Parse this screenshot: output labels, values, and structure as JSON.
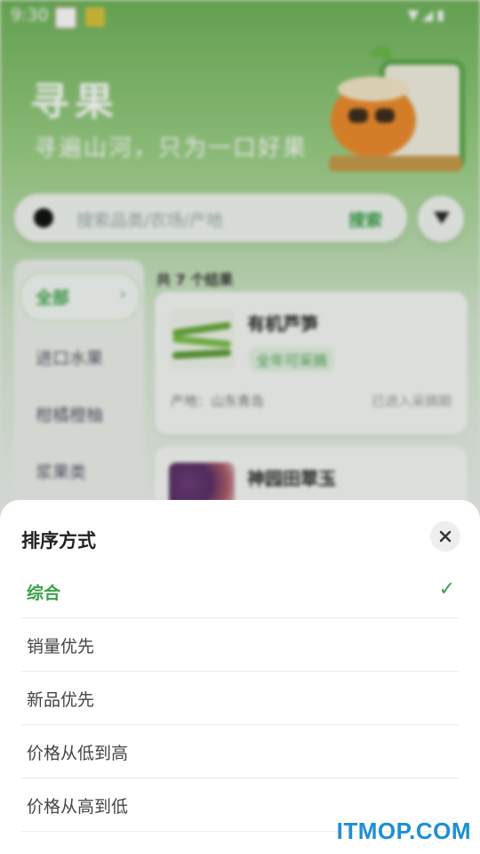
{
  "status_bar": {
    "time": "9:30"
  },
  "hero": {
    "title": "寻果",
    "subtitle": "寻遍山河，只为一口好果"
  },
  "search": {
    "placeholder": "搜索品类/农场/产地",
    "button": "搜索"
  },
  "sidebar": {
    "items": [
      {
        "label": "全部",
        "active": true
      },
      {
        "label": "进口水果",
        "active": false
      },
      {
        "label": "柑橘橙柚",
        "active": false
      },
      {
        "label": "浆果类",
        "active": false
      }
    ]
  },
  "results": {
    "count_text": "共 7 个结果",
    "cards": [
      {
        "name": "有机芦笋",
        "tag": "全年可采摘",
        "origin": "产地：山东青岛",
        "status": "已进入采摘期"
      },
      {
        "name": "神园田翠玉"
      }
    ]
  },
  "sort_sheet": {
    "title": "排序方式",
    "options": [
      {
        "label": "综合",
        "selected": true
      },
      {
        "label": "销量优先",
        "selected": false
      },
      {
        "label": "新品优先",
        "selected": false
      },
      {
        "label": "价格从低到高",
        "selected": false
      },
      {
        "label": "价格从高到低",
        "selected": false
      }
    ],
    "check_symbol": "✓"
  },
  "watermark": "ITMOP.COM",
  "colors": {
    "accent": "#3aa14a"
  }
}
